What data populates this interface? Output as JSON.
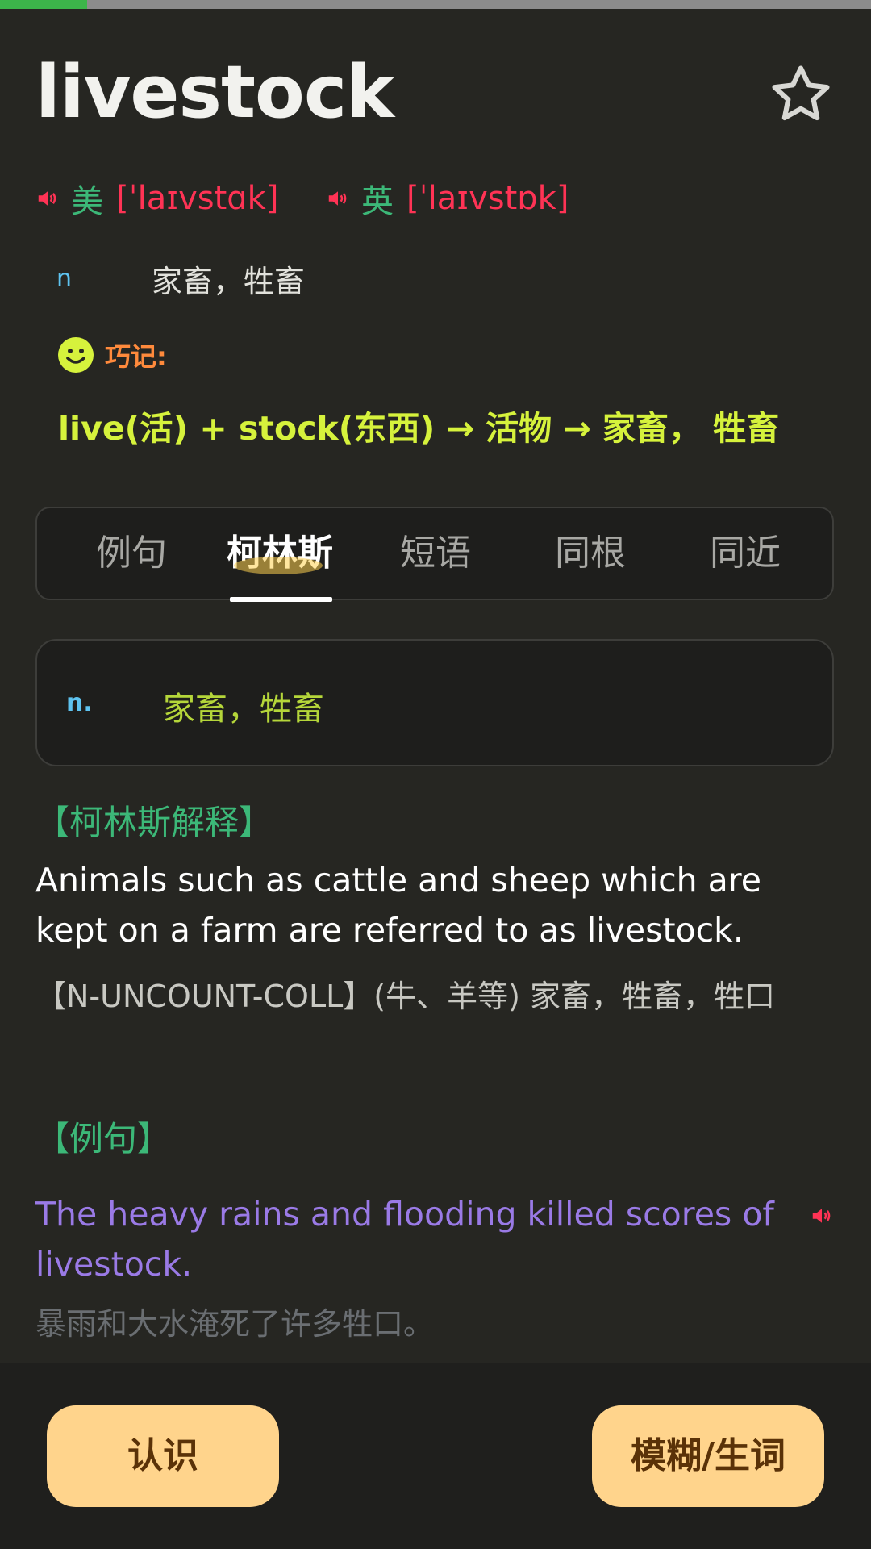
{
  "progress": {
    "fraction": 0.1
  },
  "word": {
    "text": "livestock",
    "favorite_icon": "star-outline-icon"
  },
  "pronunciation": {
    "us": {
      "label": "美",
      "ipa": "[ˈlaɪvstɑk]",
      "icon": "speaker-icon"
    },
    "uk": {
      "label": "英",
      "ipa": "[ˈlaɪvstɒk]",
      "icon": "speaker-icon"
    }
  },
  "basic_meaning": {
    "pos": "n",
    "definition": "家畜，牲畜"
  },
  "mnemonic": {
    "icon": "smiley-icon",
    "label": "巧记:",
    "text": "live(活) + stock(东西) → 活物 → 家畜， 牲畜"
  },
  "tabs": [
    {
      "label": "例句",
      "active": false
    },
    {
      "label": "柯林斯",
      "active": true
    },
    {
      "label": "短语",
      "active": false
    },
    {
      "label": "同根",
      "active": false
    },
    {
      "label": "同近",
      "active": false
    }
  ],
  "definition_card": {
    "pos": "n.",
    "text": "家畜，牲畜"
  },
  "collins": {
    "title": "【柯林斯解释】",
    "english": "Animals such as cattle and sheep which are kept on a farm are referred to as livestock.",
    "chinese": "【N-UNCOUNT-COLL】(牛、羊等) 家畜，牲畜，牲口"
  },
  "examples": {
    "title": "【例句】",
    "items": [
      {
        "en": "The heavy rains and flooding killed scores of livestock.",
        "cn": "暴雨和大水淹死了许多牲口。"
      }
    ]
  },
  "buttons": {
    "know": "认识",
    "unsure": "模糊/生词"
  },
  "colors": {
    "background": "#262622",
    "accent_green": "#3cb878",
    "phonetic_red": "#ff3355",
    "mnemonic_yellow": "#d6f23c",
    "example_purple": "#9a7ae6",
    "button_bg": "#ffd48c"
  }
}
